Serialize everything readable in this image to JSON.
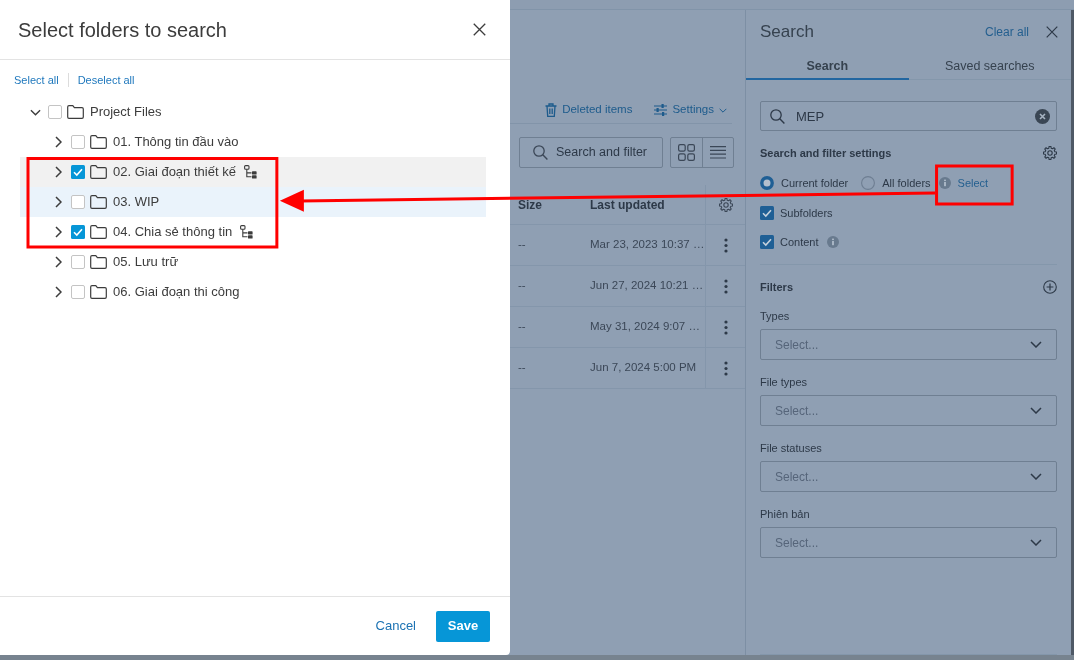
{
  "dialog": {
    "title": "Select folders to search",
    "bulk_actions": [
      "Select all",
      "Deselect all"
    ],
    "tree": [
      {
        "label": "Project Files",
        "expanded": true,
        "checked": false,
        "selected": false,
        "focused": false,
        "highlighted": false,
        "includes_subfolders": false,
        "children": [
          {
            "label": "01. Thông tin đầu vào",
            "expanded": false,
            "checked": false,
            "selected": false,
            "focused": false,
            "highlighted": false,
            "includes_subfolders": false
          },
          {
            "label": "02. Giai đoạn thiết kế",
            "expanded": false,
            "checked": true,
            "selected": true,
            "focused": false,
            "highlighted": true,
            "includes_subfolders": true
          },
          {
            "label": "03. WIP",
            "expanded": false,
            "checked": false,
            "selected": false,
            "focused": true,
            "highlighted": true,
            "includes_subfolders": false
          },
          {
            "label": "04. Chia sẻ thông tin",
            "expanded": false,
            "checked": true,
            "selected": false,
            "focused": false,
            "highlighted": true,
            "includes_subfolders": true
          },
          {
            "label": "05. Lưu trữ",
            "expanded": false,
            "checked": false,
            "selected": false,
            "focused": false,
            "highlighted": false,
            "includes_subfolders": false
          },
          {
            "label": "06. Giai đoạn thi công",
            "expanded": false,
            "checked": false,
            "selected": false,
            "focused": false,
            "highlighted": false,
            "includes_subfolders": false
          }
        ]
      }
    ],
    "buttons": [
      {
        "label": "Cancel",
        "kind": "link"
      },
      {
        "label": "Save",
        "kind": "primary"
      }
    ]
  },
  "file_list": {
    "deleted_items_link": "Deleted items",
    "settings_menu": "Settings",
    "search_button": "Search and filter",
    "columns": [
      "Size",
      "Last updated"
    ],
    "rows": [
      {
        "size": "--",
        "last_updated": "Mar 23, 2023 10:37 …"
      },
      {
        "size": "--",
        "last_updated": "Jun 27, 2024 10:21 …"
      },
      {
        "size": "--",
        "last_updated": "May 31, 2024 9:07 …"
      },
      {
        "size": "--",
        "last_updated": "Jun 7, 2024 5:00 PM"
      }
    ]
  },
  "search_panel": {
    "title": "Search",
    "clear_all": "Clear all",
    "tabs": [
      {
        "label": "Search",
        "selected": true
      },
      {
        "label": "Saved searches",
        "selected": false
      }
    ],
    "query": "MEP",
    "settings_heading": "Search and filter settings",
    "scope_options": [
      {
        "label": "Current folder",
        "selected": true,
        "info": false
      },
      {
        "label": "All folders",
        "selected": false,
        "info": true
      }
    ],
    "select_link": {
      "label": "Select",
      "highlighted": true
    },
    "options": [
      {
        "label": "Subfolders",
        "checked": true,
        "info": false
      },
      {
        "label": "Content",
        "checked": true,
        "info": true
      }
    ],
    "filters_heading": "Filters",
    "filters": [
      {
        "label": "Types",
        "placeholder": "Select..."
      },
      {
        "label": "File types",
        "placeholder": "Select..."
      },
      {
        "label": "File statuses",
        "placeholder": "Select..."
      },
      {
        "label": "Phiên bản",
        "placeholder": "Select..."
      }
    ]
  }
}
